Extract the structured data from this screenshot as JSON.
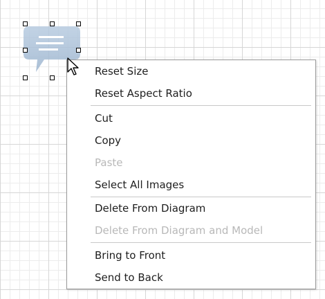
{
  "canvas": {
    "grid_color": "#d6d6d6",
    "selected_shape_icon": "speech-bubble-icon",
    "shape_color": "#a9bfd6"
  },
  "context_menu": {
    "items": [
      {
        "label": "Reset Size",
        "enabled": true
      },
      {
        "label": "Reset Aspect Ratio",
        "enabled": true
      },
      {
        "label": "Cut",
        "enabled": true
      },
      {
        "label": "Copy",
        "enabled": true
      },
      {
        "label": "Paste",
        "enabled": false
      },
      {
        "label": "Select All Images",
        "enabled": true
      },
      {
        "label": "Delete From Diagram",
        "enabled": true
      },
      {
        "label": "Delete From Diagram and Model",
        "enabled": false
      },
      {
        "label": "Bring to Front",
        "enabled": true
      },
      {
        "label": "Send to Back",
        "enabled": true
      }
    ]
  },
  "cursor": {
    "icon": "arrow-cursor-icon"
  }
}
